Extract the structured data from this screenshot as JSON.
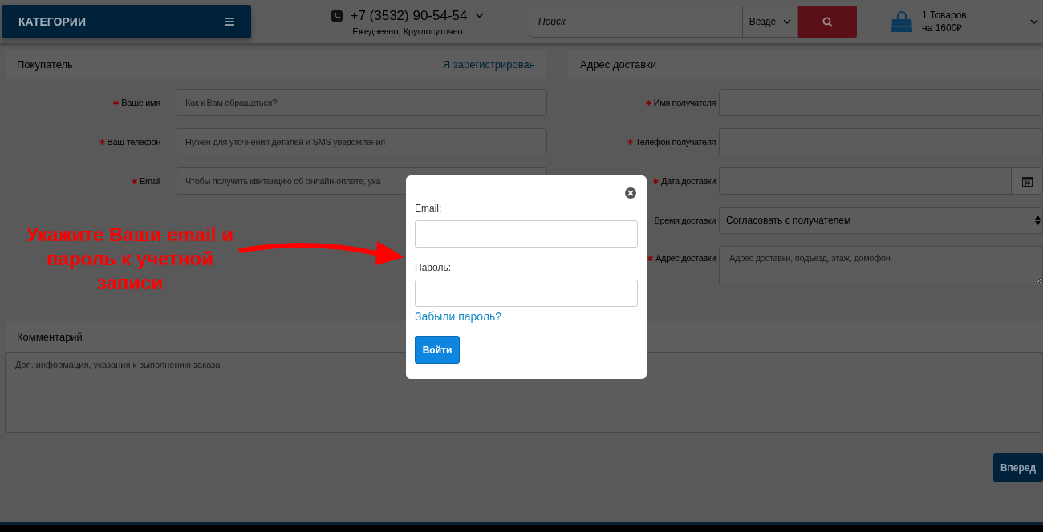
{
  "header": {
    "categories_button": "КАТЕГОРИИ",
    "phone": {
      "number": "+7 (3532) 90-54-54",
      "hours": "Ежедневно, Круглосуточно"
    },
    "search": {
      "placeholder": "Поиск",
      "scope": "Везде"
    },
    "cart": {
      "count": "1 Товаров,",
      "total": "на 1600₽"
    }
  },
  "buyer": {
    "title": "Покупатель",
    "login_link": "Я зарегистрирован",
    "fields": [
      {
        "label": "Ваше имя",
        "required": true,
        "kind": "input",
        "placeholder": "Как к Вам обращаться?"
      },
      {
        "label": "Ваш телефон",
        "required": true,
        "kind": "input",
        "placeholder": "Нужен для уточнения деталей и SMS уведомления"
      },
      {
        "label": "Email",
        "required": true,
        "kind": "input",
        "placeholder": "Чтобы получить квитанцию об онлайн-оплате, ука"
      }
    ]
  },
  "delivery": {
    "title": "Адрес доставки",
    "fields": [
      {
        "label": "Имя получателя",
        "required": true,
        "kind": "input"
      },
      {
        "label": "Телефон получателя",
        "required": true,
        "kind": "input"
      },
      {
        "label": "Дата доставки",
        "required": true,
        "kind": "date"
      },
      {
        "label": "Время доставки",
        "required": false,
        "kind": "select",
        "value": "Согласовать с получателем"
      },
      {
        "label": "Адрес доставки",
        "required": true,
        "kind": "textarea",
        "placeholder": "Адрес доставки, подъезд, этаж, домофон"
      }
    ]
  },
  "comment": {
    "title": "Комментарий",
    "placeholder": "Доп. информация, указания к выполнению заказа"
  },
  "next_button": "Вперед",
  "login_modal": {
    "email_label": "Email:",
    "password_label": "Пароль:",
    "forgot_link": "Забыли пароль?",
    "submit": "Войти"
  },
  "annotation": "Укажите Ваши email и пароль к учетной записи"
}
